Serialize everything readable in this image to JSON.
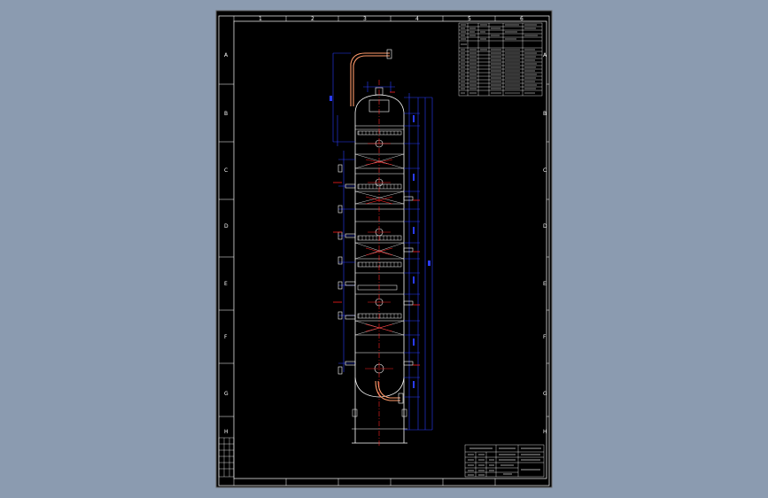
{
  "colors": {
    "viewport_bg": "#8b9bb0",
    "sheet_bg": "#000000",
    "frame": "#ffffff",
    "vessel": "#ffffff",
    "dimension": "#2a3cff",
    "centerline": "#ff2020",
    "pipe": "#ff9a6a"
  },
  "drawing": {
    "top_zone_labels": [
      "1",
      "2",
      "3",
      "4",
      "5",
      "6"
    ],
    "side_zone_labels": [
      "A",
      "B",
      "C",
      "D",
      "E",
      "F",
      "G",
      "H"
    ]
  },
  "icons": {
    "vessel": "tower-vessel-icon",
    "pipe": "pipe-icon"
  }
}
